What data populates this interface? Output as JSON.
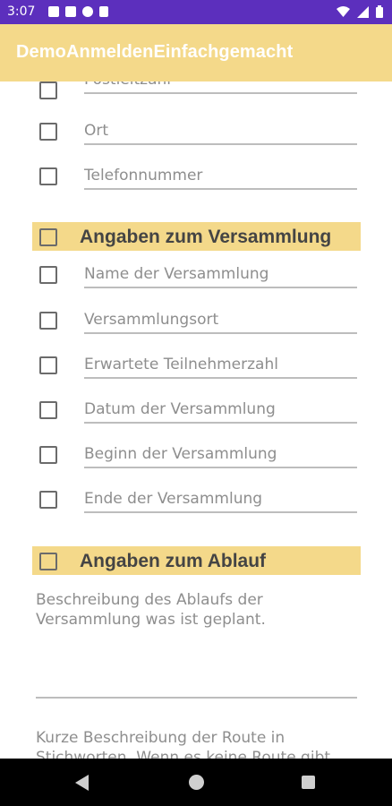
{
  "status_bar": {
    "time": "3:07",
    "icons": [
      "mail-icon",
      "image-icon",
      "sync-icon",
      "sd-card-icon",
      "wifi-icon",
      "signal-icon",
      "battery-icon"
    ]
  },
  "app_bar": {
    "title": "DemoAnmeldenEinfachgemacht"
  },
  "form": {
    "postleitzahl": "Postleitzahl",
    "ort": "Ort",
    "telefon": "Telefonnummer",
    "section_versammlung": "Angaben zum Versammlung",
    "name_versammlung": "Name der Versammlung",
    "versammlungsort": "Versammlungsort",
    "teilnehmerzahl": "Erwartete Teilnehmerzahl",
    "datum": "Datum der Versammlung",
    "beginn": "Beginn der Versammlung",
    "ende": "Ende der Versammlung",
    "section_ablauf": "Angaben zum Ablauf",
    "ablauf_desc": "Beschreibung des Ablaufs der Versammlung was ist geplant.",
    "route_desc": "Kurze Beschreibung der Route in Stichworten. Wenn es keine Route gibt"
  },
  "colors": {
    "status_bar": "#5c2fbd",
    "accent": "#f4d98a",
    "nav_bar": "#000000"
  }
}
